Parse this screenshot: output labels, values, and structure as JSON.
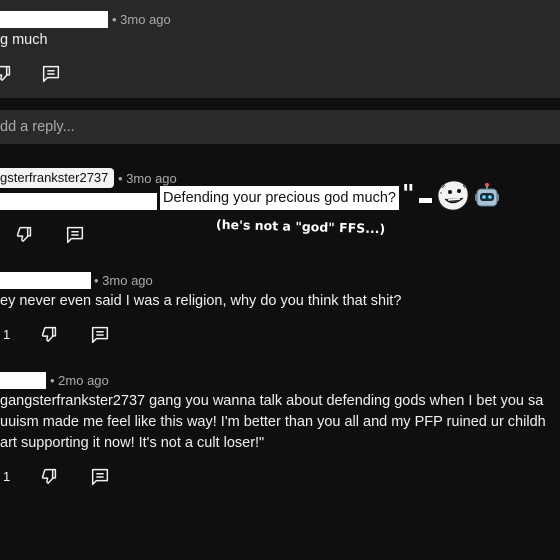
{
  "top_comment": {
    "time": "• 3mo ago",
    "text": "g much"
  },
  "reply_bar": {
    "placeholder": "dd a reply..."
  },
  "reply1": {
    "username": "gsterfrankster2737",
    "time": "• 3mo ago",
    "text": "Defending your precious god much?",
    "annotation": "(he's not a \"god\" FFS...)"
  },
  "reply2": {
    "time": "• 3mo ago",
    "text": "ey never even said I was a religion, why do you think that shit?",
    "like_count": "1"
  },
  "reply3": {
    "time": "• 2mo ago",
    "lines": [
      "gangsterfrankster2737 gang you wanna talk about defending gods when I bet you sa",
      "uuism made me feel like this way! I'm better than you all and my PFP ruined ur childh",
      "art supporting it now! It's not a cult loser!\""
    ],
    "like_count": "1"
  },
  "icons": {
    "dislike": "thumbs-down-icon",
    "reply": "comment-icon",
    "robot": "robot-emoji-icon",
    "sticker": "cartoon-face-sticker"
  }
}
